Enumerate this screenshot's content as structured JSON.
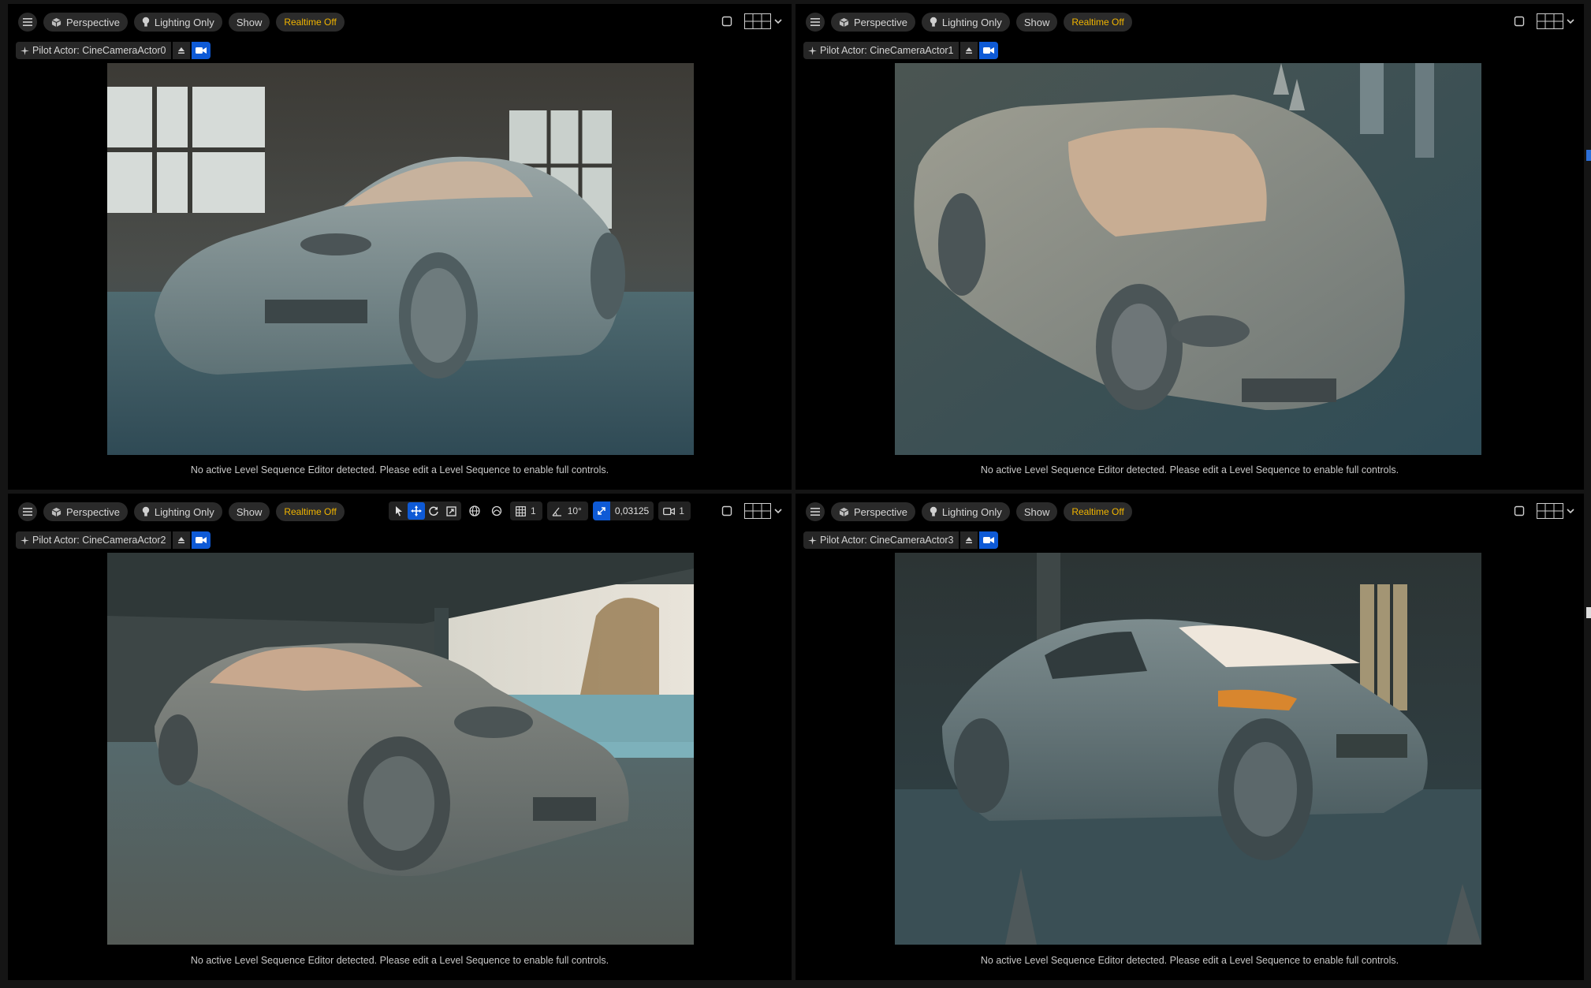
{
  "toolbar": {
    "perspective": "Perspective",
    "lighting": "Lighting Only",
    "show": "Show",
    "realtime": "Realtime Off"
  },
  "viewports": [
    {
      "pilot": "Pilot Actor: CineCameraActor0"
    },
    {
      "pilot": "Pilot Actor: CineCameraActor1"
    },
    {
      "pilot": "Pilot Actor: CineCameraActor2"
    },
    {
      "pilot": "Pilot Actor: CineCameraActor3"
    }
  ],
  "status_message": "No active Level Sequence Editor detected. Please edit a Level Sequence to enable full controls.",
  "transform": {
    "grid_snap": "1",
    "rotation_snap": "10°",
    "scale_snap": "0,03125",
    "camera_speed": "1"
  },
  "icons": {
    "menu": "hamburger-menu-icon",
    "perspective": "cube-icon",
    "lighting": "lightbulb-icon",
    "maximize": "maximize-square-icon",
    "layout": "viewport-layout-grid-icon",
    "pilot": "pilot-plane-icon",
    "eject": "eject-icon",
    "camera": "camera-icon"
  },
  "colors": {
    "accent_blue": "#0e5ad6",
    "realtime_yellow": "#f0b400",
    "panel_bg": "#000000"
  }
}
